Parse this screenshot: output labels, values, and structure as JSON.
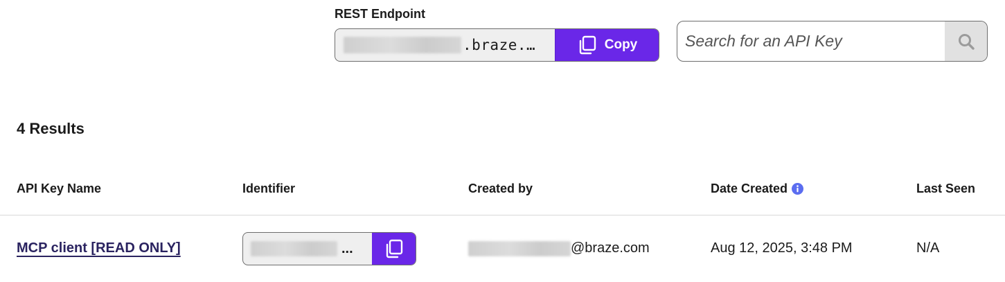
{
  "endpoint": {
    "label": "REST Endpoint",
    "value_suffix": ".braze.…",
    "copy_label": "Copy"
  },
  "search": {
    "placeholder": "Search for an API Key"
  },
  "results": {
    "count_label": "4 Results"
  },
  "table": {
    "columns": [
      "API Key Name",
      "Identifier",
      "Created by",
      "Date Created",
      "Last Seen"
    ],
    "rows": [
      {
        "name": "MCP client [READ ONLY]",
        "identifier_suffix": "...",
        "created_by_suffix": "@braze.com",
        "date_created": "Aug 12, 2025, 3:48 PM",
        "last_seen": "N/A"
      }
    ]
  },
  "colors": {
    "accent": "#6a27e8",
    "link": "#2a2360",
    "info": "#5b6df0"
  },
  "icons": {
    "copy": "copy-icon",
    "search": "search-icon",
    "info": "info-icon"
  }
}
